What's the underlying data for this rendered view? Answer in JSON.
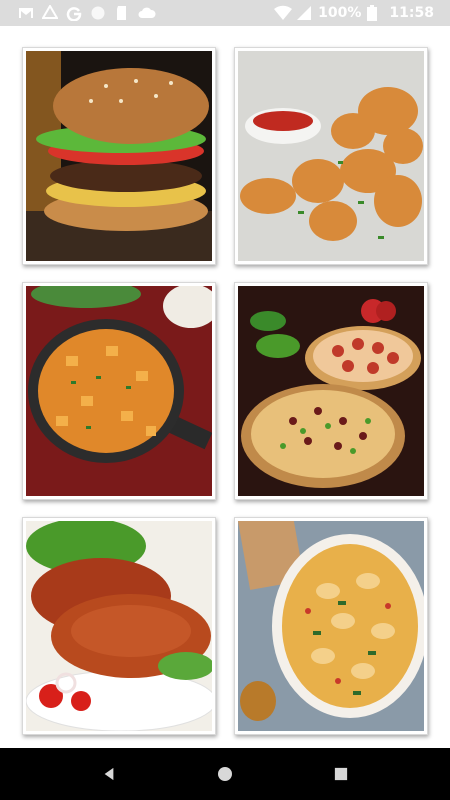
{
  "status_bar": {
    "battery_percent": "100%",
    "time": "11:58",
    "icons": [
      "gmail-icon",
      "drive-icon",
      "google-icon",
      "circle-icon",
      "sd-card-icon",
      "cloud-icon",
      "wifi-icon",
      "signal-icon",
      "battery-icon"
    ]
  },
  "gallery": {
    "items": [
      {
        "icon": "burger-image"
      },
      {
        "icon": "fried-chicken-nuggets-image"
      },
      {
        "icon": "chicken-curry-pan-image"
      },
      {
        "icon": "pizza-image"
      },
      {
        "icon": "tandoori-chicken-image"
      },
      {
        "icon": "creamy-chicken-dish-image"
      }
    ]
  },
  "navigation_bar": {
    "buttons": [
      "back-button",
      "home-button",
      "recents-button"
    ]
  },
  "colors": {
    "status_bar_bg": "#dcdcdc",
    "nav_bar_bg": "#000000",
    "page_bg": "#ffffff"
  }
}
